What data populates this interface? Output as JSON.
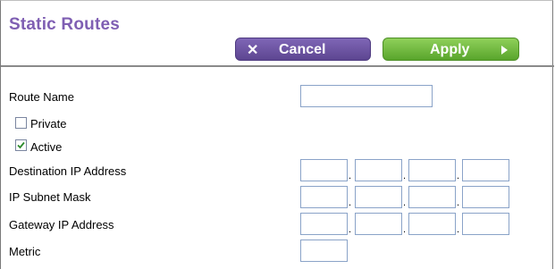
{
  "page": {
    "title": "Static Routes"
  },
  "toolbar": {
    "cancel_label": "Cancel",
    "cancel_icon": "close-icon",
    "apply_label": "Apply",
    "apply_icon": "arrow-right-icon"
  },
  "form": {
    "route_name_label": "Route Name",
    "route_name_value": "",
    "private_label": "Private",
    "private_checked": false,
    "active_label": "Active",
    "active_checked": true,
    "destination_label": "Destination IP Address",
    "destination_octets": [
      "",
      "",
      "",
      ""
    ],
    "subnet_label": "IP Subnet Mask",
    "subnet_octets": [
      "",
      "",
      "",
      ""
    ],
    "gateway_label": "Gateway IP Address",
    "gateway_octets": [
      "",
      "",
      "",
      ""
    ],
    "metric_label": "Metric",
    "metric_value": "",
    "octet_separator": "."
  },
  "colors": {
    "title": "#7f5fb3",
    "cancel_button": "#6b55a3",
    "apply_button": "#70b93f",
    "checkmark": "#2c8a2c",
    "field_border": "#8aa3c8"
  }
}
